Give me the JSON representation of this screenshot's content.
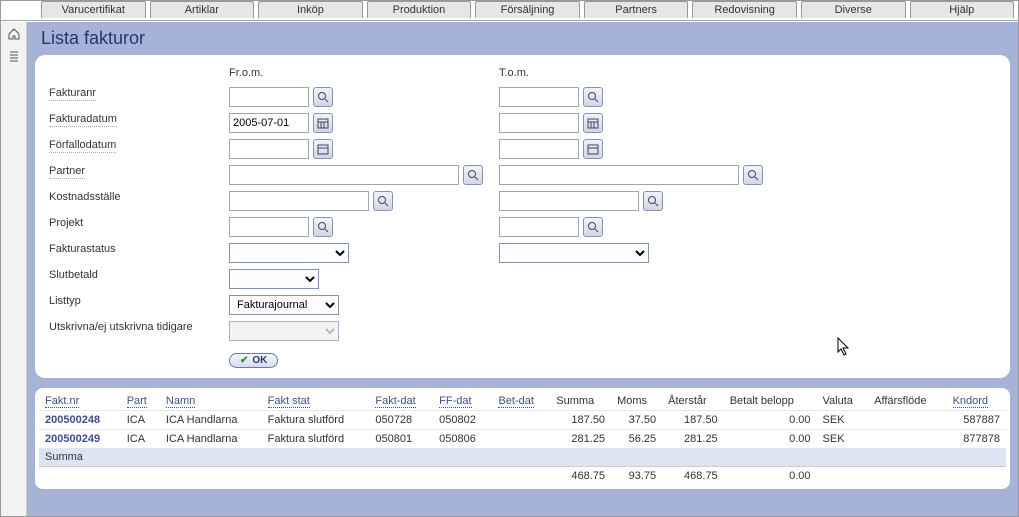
{
  "menu": [
    "Varucertifikat",
    "Artiklar",
    "Inköp",
    "Produktion",
    "Försäljning",
    "Partners",
    "Redovisning",
    "Diverse",
    "Hjälp"
  ],
  "title": "Lista fakturor",
  "headers": {
    "from": "Fr.o.m.",
    "to": "T.o.m."
  },
  "labels": {
    "fakturanr": "Fakturanr",
    "fakturadatum": "Fakturadatum",
    "forfallodatum": "Förfallodatum",
    "partner": "Partner",
    "kostnad": "Kostnadsställe",
    "projekt": "Projekt",
    "fakturastatus": "Fakturastatus",
    "slutbetald": "Slutbetald",
    "listtyp": "Listtyp",
    "utskrivna": "Utskrivna/ej utskrivna tidigare"
  },
  "values": {
    "fakturadatum_from": "2005-07-01",
    "listtyp": "Fakturajournal"
  },
  "ok": "OK",
  "table": {
    "headers": {
      "faktnr": "Fakt.nr",
      "part": "Part",
      "namn": "Namn",
      "faktstat": "Fakt stat",
      "faktdat": "Fakt-dat",
      "ffdat": "FF-dat",
      "betdat": "Bet-dat",
      "summa": "Summa",
      "moms": "Moms",
      "aterstar": "Återstår",
      "betalt": "Betalt belopp",
      "valuta": "Valuta",
      "affar": "Affärsflöde",
      "kndord": "Kndord"
    },
    "rows": [
      {
        "faktnr": "200500248",
        "part": "ICA",
        "namn": "ICA Handlarna",
        "faktstat": "Faktura slutförd",
        "faktdat": "050728",
        "ffdat": "050802",
        "betdat": "",
        "summa": "187.50",
        "moms": "37.50",
        "aterstar": "187.50",
        "betalt": "0.00",
        "valuta": "SEK",
        "affar": "",
        "kndord": "587887"
      },
      {
        "faktnr": "200500249",
        "part": "ICA",
        "namn": "ICA Handlarna",
        "faktstat": "Faktura slutförd",
        "faktdat": "050801",
        "ffdat": "050806",
        "betdat": "",
        "summa": "281.25",
        "moms": "56.25",
        "aterstar": "281.25",
        "betalt": "0.00",
        "valuta": "SEK",
        "affar": "",
        "kndord": "877878"
      }
    ],
    "sumlabel": "Summa",
    "totals": {
      "summa": "468.75",
      "moms": "93.75",
      "aterstar": "468.75",
      "betalt": "0.00"
    }
  }
}
